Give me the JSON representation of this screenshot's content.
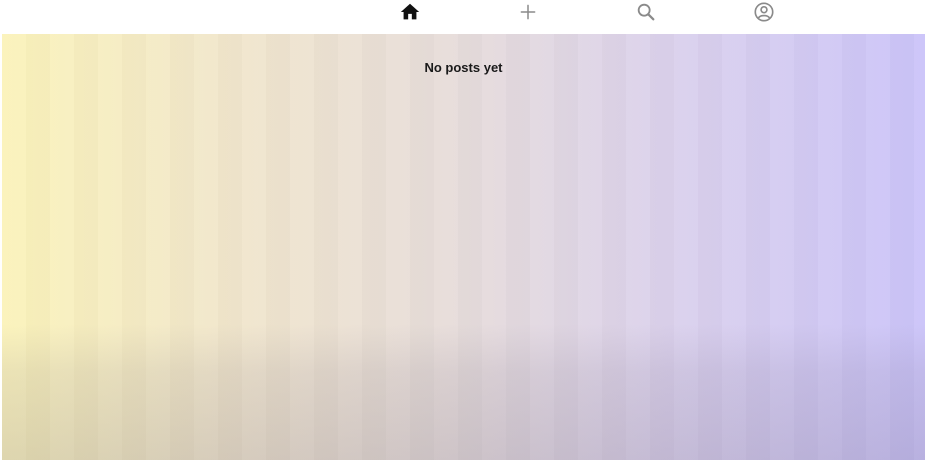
{
  "nav": {
    "items": [
      {
        "icon": "home-icon",
        "active": true
      },
      {
        "icon": "plus-icon",
        "active": false
      },
      {
        "icon": "search-icon",
        "active": false
      },
      {
        "icon": "profile-icon",
        "active": false
      }
    ],
    "active_color": "#111111",
    "inactive_color": "#8a8a8a"
  },
  "feed": {
    "empty_message": "No posts yet",
    "gradient_colors": [
      "#fbf3ba",
      "#e6dcdb",
      "#cbc4f9"
    ]
  }
}
